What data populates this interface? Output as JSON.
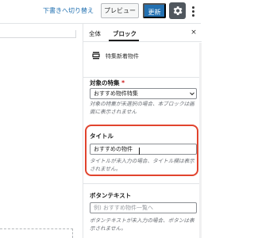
{
  "toolbar": {
    "draft_link": "下書きへ切り替え",
    "preview_label": "プレビュー",
    "publish_label": "更新"
  },
  "sidebar": {
    "tabs": [
      {
        "label": "全体"
      },
      {
        "label": "ブロック"
      }
    ],
    "close_label": "×",
    "block": {
      "icon": "list-block-icon",
      "name": "特集新着物件"
    },
    "feature": {
      "label": "対象の特集",
      "required_mark": "*",
      "selected_value": "おすすめ物件特集",
      "help": "対象の特集が未選択の場合、本ブロックは画面に表示されません"
    },
    "title": {
      "label": "タイトル",
      "value": "おすすめの物件",
      "help": "タイトルが未入力の場合、タイトル欄は表示されません。"
    },
    "button_text": {
      "label": "ボタンテキスト",
      "placeholder": "例) おすすめ物件一覧へ",
      "help": "ボタンテキストが未入力の場合、ボタンは表示されません。"
    }
  },
  "colors": {
    "accent": "#2270b1",
    "highlight": "#e1442e",
    "required": "#cc1818"
  }
}
